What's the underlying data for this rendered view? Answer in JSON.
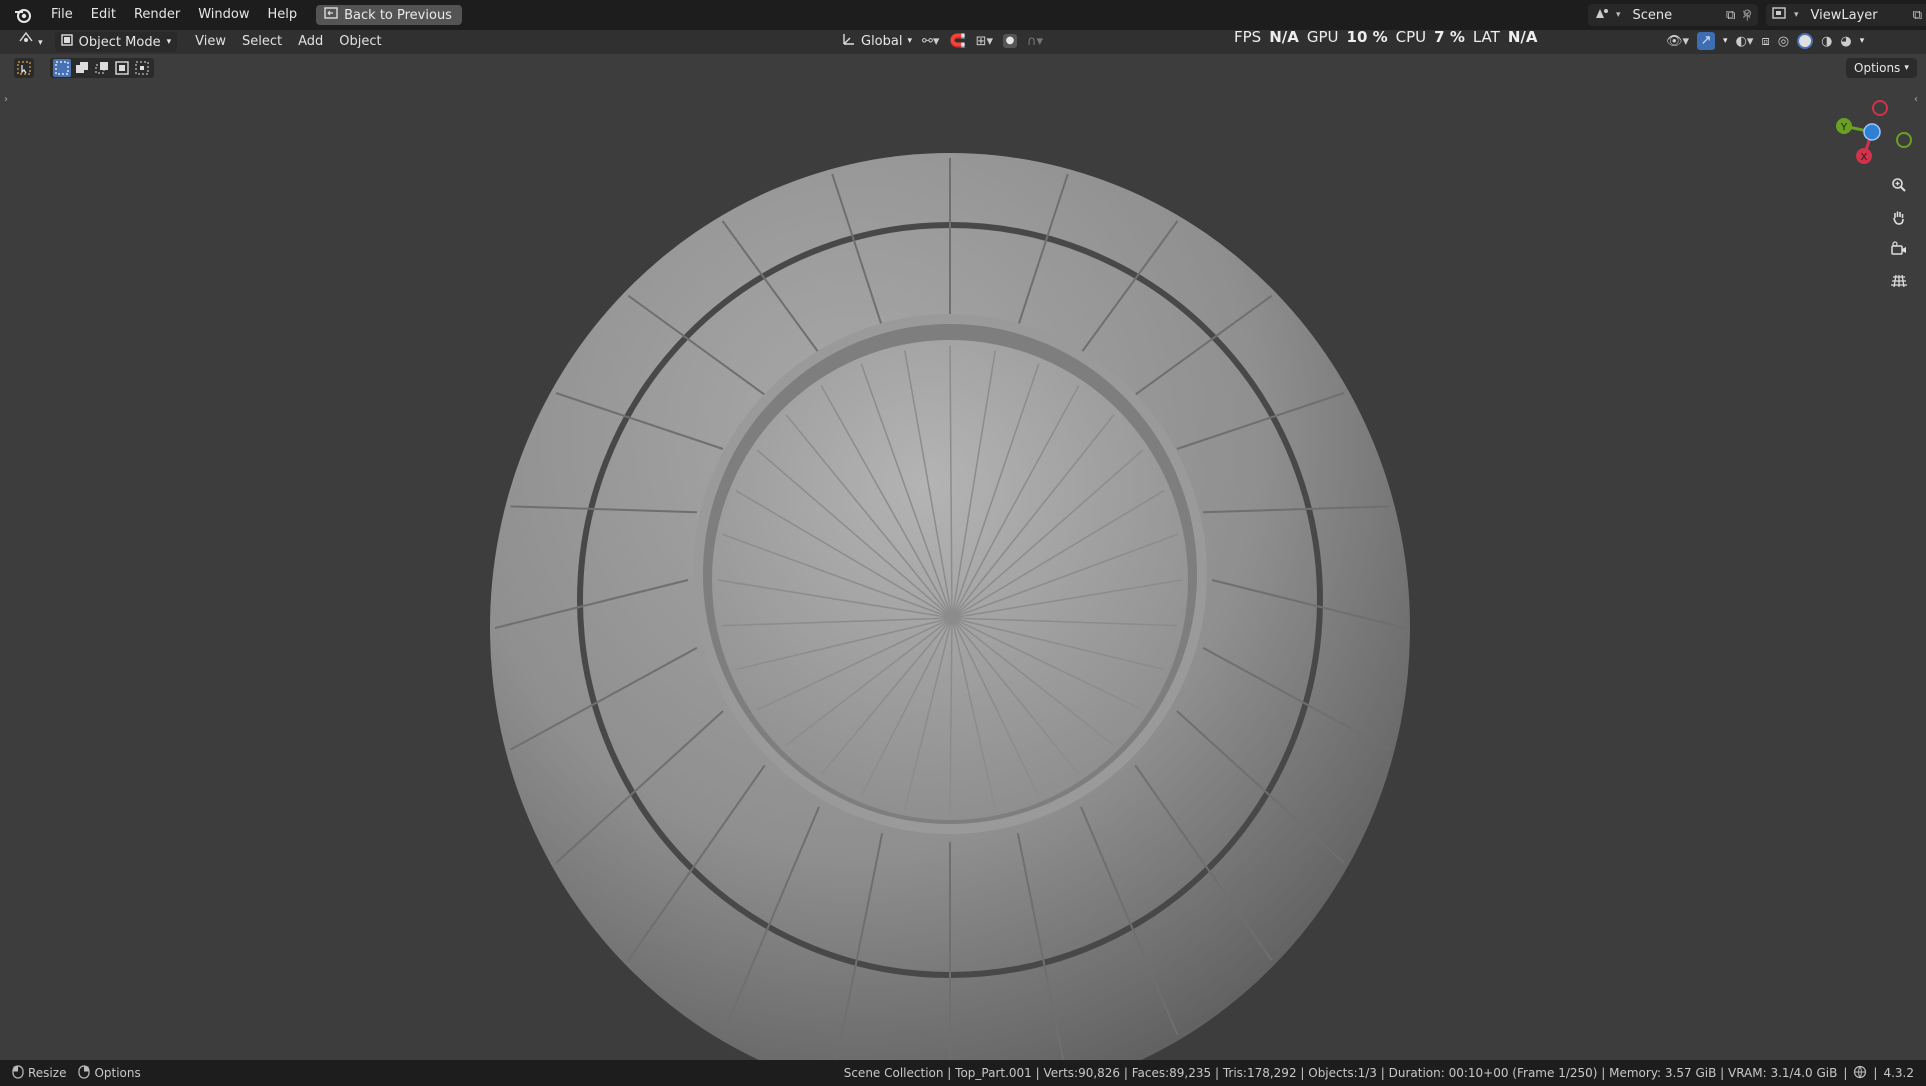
{
  "menu": [
    "File",
    "Edit",
    "Render",
    "Window",
    "Help"
  ],
  "back_button": "Back to Previous",
  "scene_name": "Scene",
  "view_layer": "ViewLayer",
  "header": {
    "mode": "Object Mode",
    "menus": [
      "View",
      "Select",
      "Add",
      "Object"
    ],
    "orientation": "Global"
  },
  "stats": {
    "fps_label": "FPS",
    "fps_value": "N/A",
    "gpu_label": "GPU",
    "gpu_value": "10 %",
    "cpu_label": "CPU",
    "cpu_value": "7 %",
    "lat_label": "LAT",
    "lat_value": "N/A"
  },
  "options_label": "Options",
  "status": {
    "left_action": "Resize",
    "left_options": "Options",
    "info": "Scene Collection | Top_Part.001 | Verts:90,826 | Faces:89,235 | Tris:178,292 | Objects:1/3 | Duration: 00:10+00 (Frame 1/250) | Memory: 3.57 GiB | VRAM: 3.1/4.0 GiB",
    "version": "4.3.2"
  },
  "gizmo": {
    "y_label": "Y",
    "x_label": "X",
    "x_color": "#d0334b",
    "y_color": "#6aa024",
    "z_color": "#2f7fd3"
  },
  "icons": {
    "logo": "blender-logo-icon",
    "zoom": "zoom-icon",
    "pan": "hand-icon",
    "camera": "camera-icon",
    "grid": "grid-icon"
  }
}
